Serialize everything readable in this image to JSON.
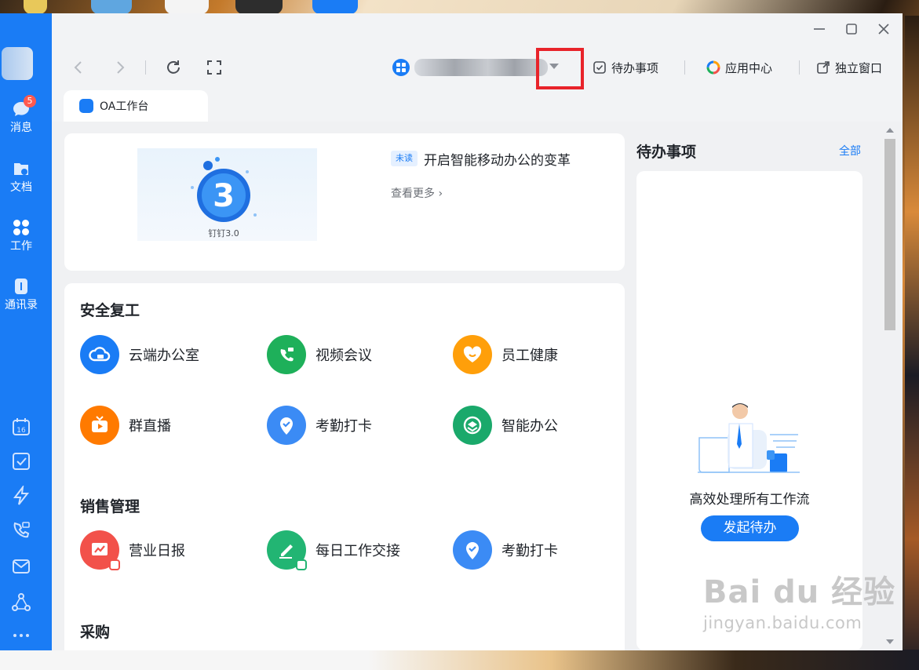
{
  "sidebar": {
    "badge_count": "5",
    "items": [
      {
        "label": "消息"
      },
      {
        "label": "文档"
      },
      {
        "label": "工作"
      },
      {
        "label": "通讯录"
      }
    ],
    "tools": [
      "calendar-icon",
      "todo-check-icon",
      "lightning-icon",
      "phone-video-icon",
      "mail-icon",
      "share-nodes-icon",
      "more-dots-icon"
    ],
    "calendar_day": "16",
    "accent": "#1a7cf5"
  },
  "toolbar": {
    "todo_label": "待办事项",
    "app_center_label": "应用中心",
    "standalone_label": "独立窗口"
  },
  "tab": {
    "label": "OA工作台"
  },
  "banner": {
    "badge": "未读",
    "title": "开启智能移动办公的变革",
    "more": "查看更多",
    "image_caption": "钉钉3.0",
    "image_big_number": "3"
  },
  "sections": [
    {
      "title": "安全复工",
      "apps": [
        {
          "label": "云端办公室",
          "icon": "cloud-office-icon",
          "color": "#1a7cf5"
        },
        {
          "label": "视频会议",
          "icon": "video-call-icon",
          "color": "#1eb05a"
        },
        {
          "label": "员工健康",
          "icon": "heart-icon",
          "color": "#ff9f0a"
        },
        {
          "label": "群直播",
          "icon": "live-tv-icon",
          "color": "#ff7a00"
        },
        {
          "label": "考勤打卡",
          "icon": "location-check-icon",
          "color": "#3b8bf5"
        },
        {
          "label": "智能办公",
          "icon": "smart-office-icon",
          "color": "#1aa96b"
        }
      ]
    },
    {
      "title": "销售管理",
      "apps": [
        {
          "label": "营业日报",
          "icon": "report-chart-icon",
          "color": "#f2514a"
        },
        {
          "label": "每日工作交接",
          "icon": "handover-pen-icon",
          "color": "#22b573"
        },
        {
          "label": "考勤打卡",
          "icon": "location-check-icon",
          "color": "#3b8bf5"
        }
      ]
    },
    {
      "title": "采购",
      "apps": []
    }
  ],
  "todo": {
    "title": "待办事项",
    "all": "全部",
    "empty_text": "高效处理所有工作流",
    "button": "发起待办"
  },
  "watermark": {
    "line1": "Bai du 经验",
    "line2": "jingyan.baidu.com"
  }
}
